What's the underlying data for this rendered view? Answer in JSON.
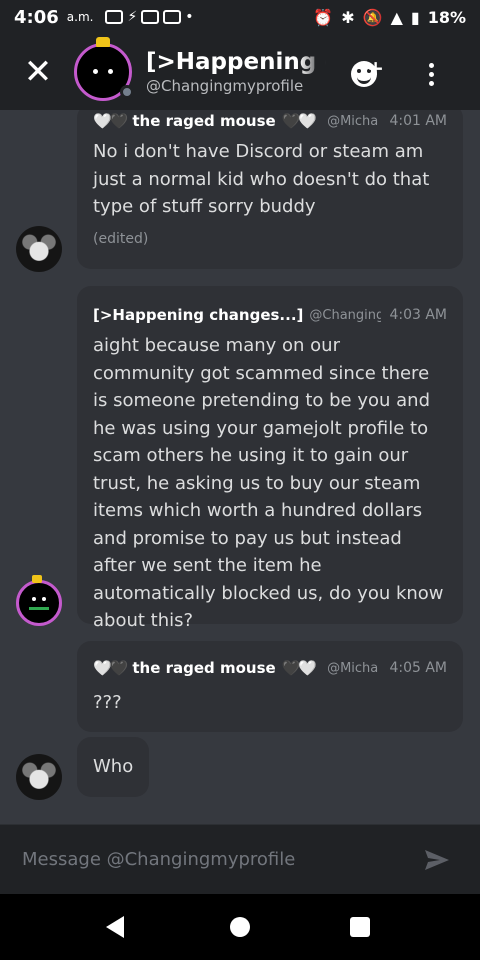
{
  "status_bar": {
    "time": "4:06",
    "ampm": "a.m.",
    "battery": "18%"
  },
  "header": {
    "title": "[>Happening c",
    "subtitle": "@Changingmyprofile"
  },
  "messages": [
    {
      "hearts": "🤍🖤",
      "hearts_after": "🖤🤍",
      "author": "the raged mouse",
      "handle": "@Micha",
      "time": "4:01 AM",
      "text": "No i don't have Discord or steam am just a normal kid who doesn't do that type of stuff sorry buddy",
      "edited": "(edited)"
    },
    {
      "author": "[>Happening changes...]",
      "handle": "@Changingm",
      "time": "4:03 AM",
      "text": "aight because many on our community got scammed since there is someone pretending to be you and he was using your gamejolt profile to scam others he using it to gain our trust, he asking us to buy our steam items which worth a hundred dollars and promise to pay us but instead after we sent the item he automatically blocked us, do you know about this?"
    },
    {
      "hearts": "🤍🖤",
      "hearts_after": "🖤🤍",
      "author": "the raged mouse",
      "handle": "@Micha",
      "time": "4:05 AM",
      "text": "???"
    },
    {
      "text": "Who"
    }
  ],
  "composer": {
    "placeholder": "Message @Changingmyprofile"
  },
  "colors": {
    "background": "#36393f",
    "bubble": "#2f3136",
    "header": "#202225",
    "avatar_ring": "#c45acd"
  },
  "icons": [
    "close-icon",
    "add-friend-icon",
    "more-options-icon",
    "send-icon",
    "back-icon",
    "home-icon",
    "recents-icon"
  ]
}
